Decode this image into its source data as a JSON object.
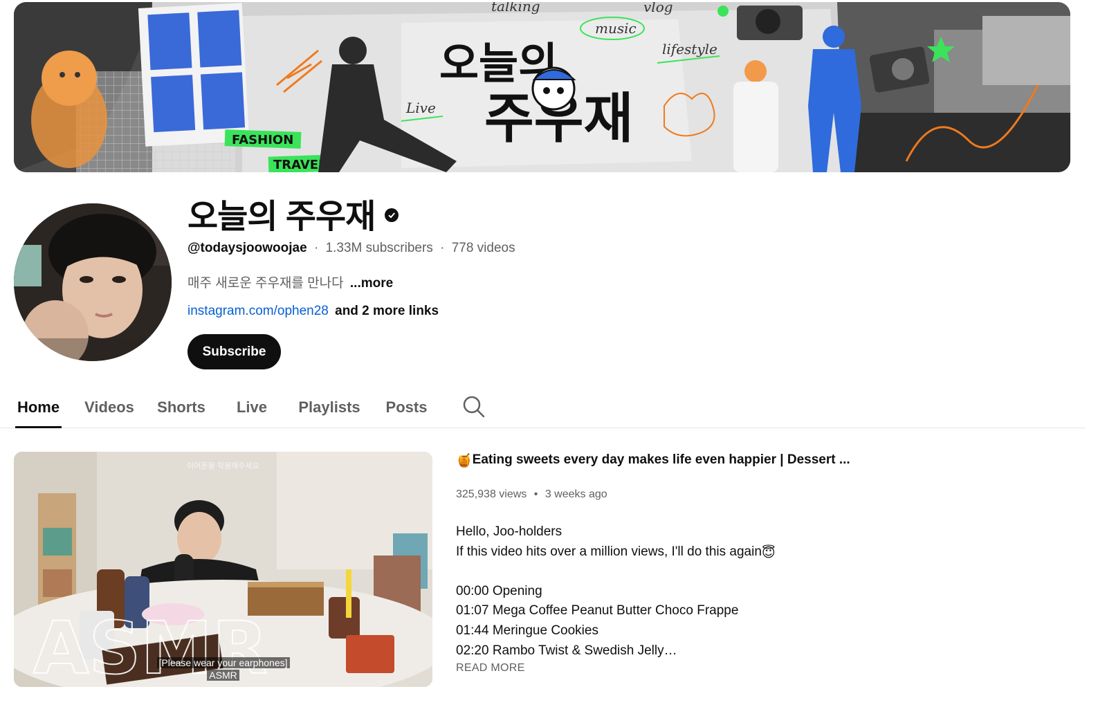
{
  "banner": {
    "title_line1": "오늘의",
    "title_line2": "주우재",
    "tags": [
      "talking",
      "vlog",
      "music",
      "lifestyle",
      "Live"
    ],
    "stickers": [
      "FASHION",
      "TRAVEL"
    ]
  },
  "channel": {
    "name": "오늘의 주우재",
    "handle": "@todaysjoowoojae",
    "subscribers": "1.33M subscribers",
    "videos": "778 videos",
    "separator": "·",
    "description": "매주 새로운 주우재를 만나다",
    "description_more": "...more",
    "link": "instagram.com/ophen28",
    "more_links": "and 2 more links",
    "subscribe_label": "Subscribe"
  },
  "tabs": [
    {
      "label": "Home",
      "active": true
    },
    {
      "label": "Videos",
      "active": false
    },
    {
      "label": "Shorts",
      "active": false
    },
    {
      "label": "Live",
      "active": false
    },
    {
      "label": "Playlists",
      "active": false
    },
    {
      "label": "Posts",
      "active": false
    }
  ],
  "featured": {
    "title": "Eating sweets every day makes life even happier | Dessert ...",
    "title_emoji": "🍯",
    "views": "325,938 views",
    "age": "3 weeks ago",
    "stats_separator": "•",
    "description_lines": [
      "Hello, Joo-holders",
      "If this video hits over a million views, I'll do this again",
      "",
      "00:00 Opening",
      "01:07 Mega Coffee Peanut Butter Choco Frappe",
      "01:44 Meringue Cookies",
      "02:20 Rambo Twist & Swedish Jelly…"
    ],
    "line2_emoji": "😇",
    "read_more": "READ MORE",
    "thumbnail": {
      "top_caption": "이어폰을 착용해주세요",
      "caption_line1": "[Please wear your earphones]",
      "caption_line2": "ASMR",
      "overlay_word": "ASMR"
    }
  },
  "colors": {
    "accent_green": "#3be35a",
    "accent_orange": "#f07a1c",
    "accent_blue": "#2f6bdc",
    "link_blue": "#065fd4",
    "subscribe_bg": "#0f0f0f"
  }
}
